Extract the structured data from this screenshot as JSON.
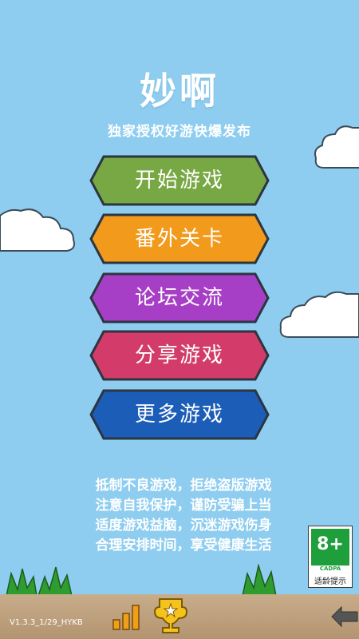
{
  "title": "妙啊",
  "subtitle": "独家授权好游快爆发布",
  "menu": [
    {
      "label": "开始游戏",
      "color": "#78a843"
    },
    {
      "label": "番外关卡",
      "color": "#f19a1c"
    },
    {
      "label": "论坛交流",
      "color": "#a63fc6"
    },
    {
      "label": "分享游戏",
      "color": "#d33c6a"
    },
    {
      "label": "更多游戏",
      "color": "#1c5db8"
    }
  ],
  "notice": [
    "抵制不良游戏，拒绝盗版游戏",
    "注意自我保护，谨防受骗上当",
    "适度游戏益脑，沉迷游戏伤身",
    "合理安排时间，享受健康生活"
  ],
  "age_rating": {
    "label": "8+",
    "org": "CADPA",
    "tip": "适龄提示"
  },
  "version": "V1.3.3_1/29_HYKB",
  "icons": {
    "rank": "bar-chart-icon",
    "trophy": "trophy-icon"
  },
  "colors": {
    "sky": "#8ecdf0",
    "bar": "#c0a27e"
  }
}
